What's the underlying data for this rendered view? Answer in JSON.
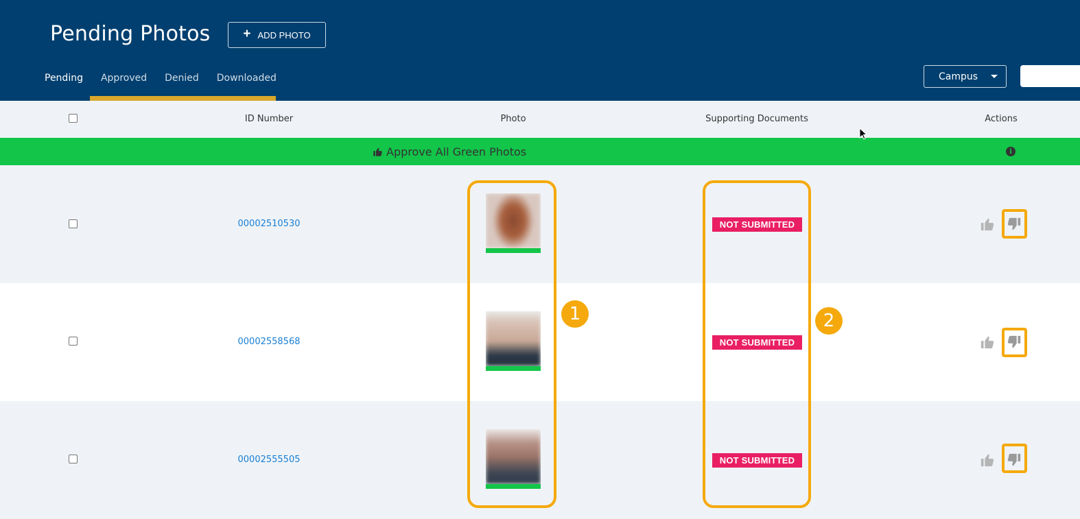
{
  "header": {
    "title": "Pending Photos",
    "add_photo_label": "ADD PHOTO",
    "tabs": [
      {
        "label": "Pending",
        "active": true
      },
      {
        "label": "Approved",
        "active": false
      },
      {
        "label": "Denied",
        "active": false
      },
      {
        "label": "Downloaded",
        "active": false
      }
    ],
    "campus_select": {
      "value": "Campus"
    },
    "search": {
      "placeholder": ""
    }
  },
  "table": {
    "columns": {
      "id_number": "ID Number",
      "photo": "Photo",
      "supporting_documents": "Supporting Documents",
      "actions": "Actions"
    },
    "approve_all_label": "Approve All Green Photos",
    "rows": [
      {
        "id_number": "00002510530",
        "photo_status_color": "#13c549",
        "documents_status": "NOT SUBMITTED"
      },
      {
        "id_number": "00002558568",
        "photo_status_color": "#13c549",
        "documents_status": "NOT SUBMITTED"
      },
      {
        "id_number": "00002555505",
        "photo_status_color": "#13c549",
        "documents_status": "NOT SUBMITTED"
      }
    ]
  },
  "annotations": {
    "marker_1": "1",
    "marker_2": "2"
  },
  "colors": {
    "header_bg": "#003f6f",
    "tab_underline": "#d9a72c",
    "approve_bar": "#13c549",
    "badge": "#e91e63",
    "highlight": "#f5a90d",
    "link": "#1a7fd4"
  }
}
